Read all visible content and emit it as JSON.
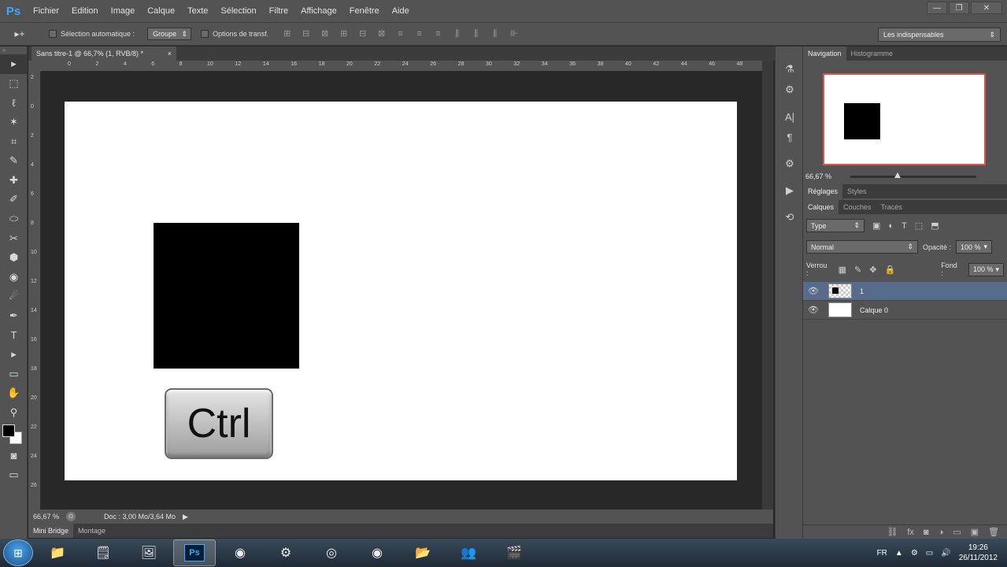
{
  "app": {
    "logo": "Ps"
  },
  "menu": [
    "Fichier",
    "Edition",
    "Image",
    "Calque",
    "Texte",
    "Sélection",
    "Filtre",
    "Affichage",
    "Fenêtre",
    "Aide"
  ],
  "window_controls": {
    "minimize": "—",
    "restore": "❐",
    "close": "✕"
  },
  "options_bar": {
    "tool_glyph": "▸+",
    "auto_select_label": "Sélection automatique :",
    "auto_select_value": "Groupe",
    "transform_label": "Options de transf.",
    "workspace": "Les indispensables",
    "align_icons": [
      "⊞",
      "⊟",
      "⊠",
      "⊞",
      "⊟",
      "⊠",
      "≡",
      "≡",
      "≡",
      "⫼",
      "⫼",
      "⫼",
      "⊪"
    ]
  },
  "document": {
    "tab_title": "Sans titre-1 @ 66,7% (1, RVB/8) *",
    "tab_close": "×",
    "key_label": "Ctrl"
  },
  "ruler": {
    "h_ticks": [
      "0",
      "2",
      "4",
      "6",
      "8",
      "10",
      "12",
      "14",
      "16",
      "18",
      "20",
      "22",
      "24",
      "26",
      "28",
      "30",
      "32",
      "34",
      "36",
      "38",
      "40",
      "42",
      "44",
      "46",
      "48"
    ],
    "v_ticks": [
      "2",
      "0",
      "2",
      "4",
      "6",
      "8",
      "10",
      "12",
      "14",
      "16",
      "18",
      "20",
      "22",
      "24",
      "26"
    ]
  },
  "tools": [
    "▸",
    "⬚",
    "ℓ",
    "✶",
    "⌗",
    "✎",
    "✚",
    "✐",
    "⬭",
    "✂",
    "⬢",
    "◉",
    "☄",
    "✒",
    "T",
    "▸",
    "▭",
    "✋",
    "⚲"
  ],
  "status": {
    "zoom": "66,67 %",
    "doc": "Doc : 3,00 Mo/3,64 Mo",
    "arrow": "▶"
  },
  "bottom_tabs": [
    "Mini Bridge",
    "Montage"
  ],
  "dock_icons": [
    "⚗",
    "⚙",
    "A|",
    "¶",
    "⚙",
    "▶",
    "⟲"
  ],
  "navigation": {
    "tabs": [
      "Navigation",
      "Histogramme"
    ],
    "zoom": "66,67 %"
  },
  "adjustments_tabs": [
    "Réglages",
    "Styles"
  ],
  "layers_panel": {
    "tabs": [
      "Calques",
      "Couches",
      "Tracés"
    ],
    "filter_value": "Type",
    "filter_icons": [
      "▣",
      "◐",
      "T",
      "⬚",
      "⬒"
    ],
    "blend_mode": "Normal",
    "opacity_label": "Opacité :",
    "opacity_value": "100 %",
    "lock_label": "Verrou :",
    "lock_icons": [
      "▦",
      "✎",
      "✥",
      "🔒"
    ],
    "fill_label": "Fond :",
    "fill_value": "100 %",
    "layers": [
      {
        "name": "1",
        "selected": true
      },
      {
        "name": "Calque 0",
        "selected": false
      }
    ],
    "bottom_icons": [
      "⛓",
      "fx",
      "◙",
      "◑",
      "▭",
      "▣",
      "🗑"
    ]
  },
  "taskbar": {
    "apps": [
      "📁",
      "🗒",
      "🖼",
      "Ps",
      "◉",
      "⚙",
      "◎",
      "◉",
      "📂",
      "👥",
      "🎬"
    ],
    "language": "FR",
    "tray_icons": [
      "▲",
      "⚙",
      "▭",
      "🔊"
    ],
    "time": "19:26",
    "date": "26/11/2012"
  }
}
